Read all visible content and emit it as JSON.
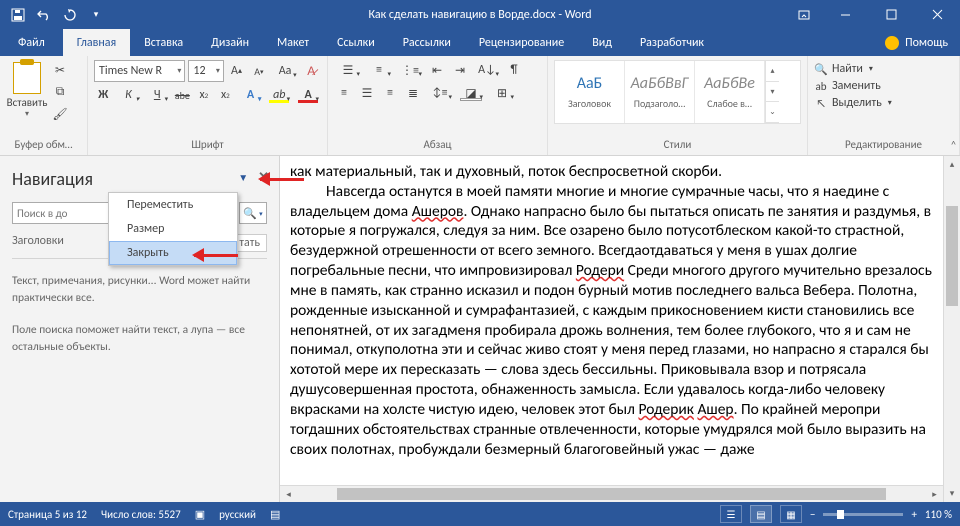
{
  "titlebar": {
    "title": "Как сделать навигацию в Ворде.docx - Word"
  },
  "tabs": {
    "file": "Файл",
    "home": "Главная",
    "insert": "Вставка",
    "design": "Дизайн",
    "layout": "Макет",
    "references": "Ссылки",
    "mailings": "Рассылки",
    "review": "Рецензирование",
    "view": "Вид",
    "developer": "Разработчик",
    "help": "Помощь"
  },
  "ribbon": {
    "clipboard": {
      "label": "Буфер обм…",
      "paste": "Вставить"
    },
    "font": {
      "label": "Шрифт",
      "name": "Times New R",
      "size": "12",
      "bold": "Ж",
      "italic": "К",
      "underline": "Ч",
      "strike": "abe",
      "clear_label": "Aa"
    },
    "paragraph": {
      "label": "Абзац"
    },
    "styles": {
      "label": "Стили",
      "items": [
        {
          "preview": "АаБ",
          "name": "Заголовок",
          "cls": "blue"
        },
        {
          "preview": "АаБбВвГ",
          "name": "Подзаголо…",
          "cls": "it"
        },
        {
          "preview": "АаБбВе",
          "name": "Слабое в…",
          "cls": "it"
        }
      ]
    },
    "editing": {
      "label": "Редактирование",
      "find": "Найти",
      "replace": "Заменить",
      "select": "Выделить"
    }
  },
  "nav": {
    "title": "Навигация",
    "search_placeholder": "Поиск в до",
    "tab_headings": "Заголовки",
    "tab_results_partial": "тать",
    "help1": "Текст, примечания, рисунки... Word может найти практически все.",
    "help2": "Поле поиска поможет найти текст, а лупа — все остальные объекты.",
    "menu": {
      "move": "Переместить",
      "size": "Размер",
      "close": "Закрыть"
    }
  },
  "document": {
    "line1": "как материальный, так и духовный, поток беспросветной скорби.",
    "para": "Навсегда останутся в моей памяти многие и многие сумрачные часы, что я наедине с владельцем дома ",
    "ashers": "Ашеров",
    "para2": ". Однако напрасно было бы пытаться описать пе занятия и раздумья, в которые я погружался, следуя за ним. Все озарено было потусотблеском какой-то страстной, безудержной отрешенности от всего земного. Всегдаотдаваться у меня в ушах долгие погребальные песни, что импровизировал ",
    "roderi": "Родери",
    "para3": "Среди многого другого мучительно врезалось мне в память, как странно исказил и подон бурный мотив последнего вальса Вебера. Полотна, рожденные изысканной и сумрафантазией, с каждым прикосновением кисти становились все непонятней, от их загадменя пробирала дрожь волнения, тем более глубокого, что я и сам не понимал, откуполотна эти и сейчас живо стоят у меня перед глазами, но напрасно я старался бы хототой мере их пересказать — слова здесь бессильны. Приковывала взор и потрясала душусовершенная простота, обнаженность замысла. Если удавалось когда-либо человеку вкрасками на холсте чистую идею, человек этот был ",
    "roderick": "Родерик",
    "asher2": "Ашер",
    "para4": ". По крайней меропри тогдашних обстоятельствах странные отвлеченности, которые умудрялся мой было выразить на своих полотнах, пробуждали безмерный благоговейный ужас — даже"
  },
  "status": {
    "page": "Страница 5 из 12",
    "words": "Число слов: 5527",
    "lang": "русский",
    "zoom": "110 %"
  }
}
